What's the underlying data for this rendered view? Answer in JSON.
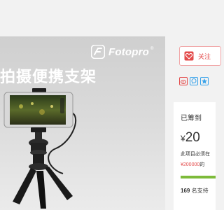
{
  "brand": {
    "name": "Fotopro",
    "reg_mark": "®"
  },
  "banner": {
    "headline": "拍摄便携支架"
  },
  "actions": {
    "follow_label": "关注",
    "share": [
      "weibo-icon",
      "wechat-icon",
      "star-icon"
    ]
  },
  "funding": {
    "raised_label": "已筹到",
    "currency": "¥",
    "amount": "20",
    "note": "此项目必须在",
    "target": "¥200000",
    "target_suffix": "的",
    "progress_fraction": 1.0,
    "supporters_count": "169",
    "supporters_text": "名支持"
  },
  "colors": {
    "accent_red": "#e34b4b",
    "progress_green": "#7dbb3a",
    "share_blue": "#3aa3ea"
  }
}
